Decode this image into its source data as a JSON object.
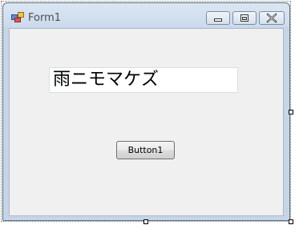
{
  "window": {
    "title": "Form1",
    "icon": "form-icon",
    "controls": {
      "minimize_icon": "minimize-icon",
      "maximize_icon": "maximize-icon",
      "close_icon": "close-icon"
    }
  },
  "form": {
    "textbox_value": "雨ニモマケズ",
    "button_label": "Button1"
  },
  "colors": {
    "title_gradient_top": "#dbe6f3",
    "client_background": "#f0f0f0"
  }
}
